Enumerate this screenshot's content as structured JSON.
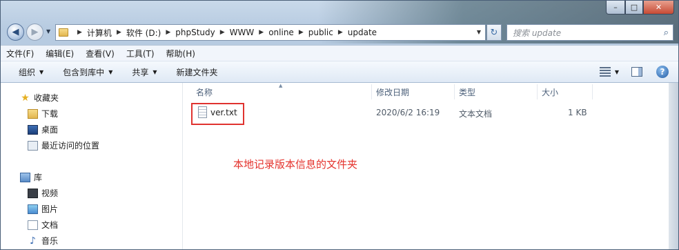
{
  "window": {
    "caption_buttons": {
      "minimize": "–",
      "maximize": "□",
      "close": "✕"
    }
  },
  "navigation": {
    "back_icon": "back-arrow-icon",
    "forward_icon": "forward-arrow-icon",
    "breadcrumbs": [
      "计算机",
      "软件 (D:)",
      "phpStudy",
      "WWW",
      "online",
      "public",
      "update"
    ],
    "search_placeholder": "搜索 update"
  },
  "menubar": {
    "items": [
      "文件(F)",
      "编辑(E)",
      "查看(V)",
      "工具(T)",
      "帮助(H)"
    ]
  },
  "commandbar": {
    "organize": "组织",
    "include_in_library": "包含到库中",
    "share": "共享",
    "new_folder": "新建文件夹"
  },
  "navpane": {
    "favorites": {
      "label": "收藏夹",
      "items": [
        "下载",
        "桌面",
        "最近访问的位置"
      ]
    },
    "libraries": {
      "label": "库",
      "items": [
        "视频",
        "图片",
        "文档",
        "音乐"
      ]
    }
  },
  "filelist": {
    "columns": {
      "name": "名称",
      "modified": "修改日期",
      "type": "类型",
      "size": "大小"
    },
    "files": [
      {
        "name": "ver.txt",
        "modified": "2020/6/2 16:19",
        "type": "文本文档",
        "size": "1 KB"
      }
    ]
  },
  "annotation": {
    "text": "本地记录版本信息的文件夹",
    "color": "#e4322c"
  }
}
